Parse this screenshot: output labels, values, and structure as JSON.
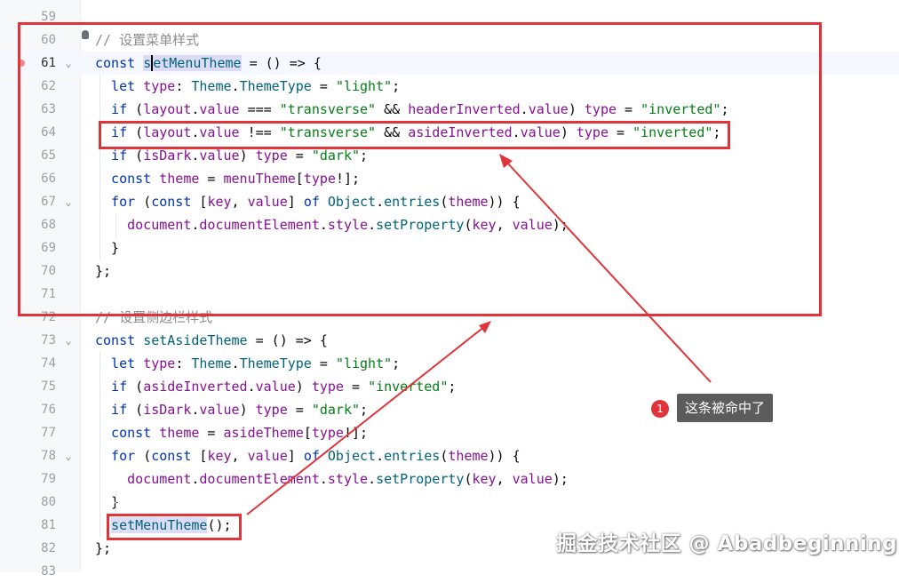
{
  "editor": {
    "lines": [
      {
        "num": "59",
        "fold": "",
        "parts": []
      },
      {
        "num": "60",
        "fold": "",
        "parts": [
          {
            "t": "// 设置菜单样式",
            "c": "cm"
          }
        ]
      },
      {
        "num": "61",
        "fold": "⌄",
        "current": true,
        "parts": [
          {
            "t": "const ",
            "c": "kw"
          },
          {
            "t": "s",
            "c": "fn hl"
          },
          {
            "t": "etMenuTheme",
            "c": "fn hl caret"
          },
          {
            "t": " = () => {",
            "c": ""
          }
        ]
      },
      {
        "num": "62",
        "fold": "",
        "parts": [
          {
            "t": "  let ",
            "c": "kw"
          },
          {
            "t": "type",
            "c": "id"
          },
          {
            "t": ": ",
            "c": ""
          },
          {
            "t": "Theme",
            "c": "type"
          },
          {
            "t": ".",
            "c": ""
          },
          {
            "t": "ThemeType",
            "c": "type"
          },
          {
            "t": " = ",
            "c": ""
          },
          {
            "t": "\"light\"",
            "c": "str"
          },
          {
            "t": ";",
            "c": ""
          }
        ]
      },
      {
        "num": "63",
        "fold": "",
        "parts": [
          {
            "t": "  if ",
            "c": "kw"
          },
          {
            "t": "(",
            "c": ""
          },
          {
            "t": "layout",
            "c": "id"
          },
          {
            "t": ".",
            "c": ""
          },
          {
            "t": "value",
            "c": "prop"
          },
          {
            "t": " === ",
            "c": ""
          },
          {
            "t": "\"transverse\"",
            "c": "str"
          },
          {
            "t": " && ",
            "c": ""
          },
          {
            "t": "headerInverted",
            "c": "id"
          },
          {
            "t": ".",
            "c": ""
          },
          {
            "t": "value",
            "c": "prop"
          },
          {
            "t": ") ",
            "c": ""
          },
          {
            "t": "type",
            "c": "id"
          },
          {
            "t": " = ",
            "c": ""
          },
          {
            "t": "\"inverted\"",
            "c": "str"
          },
          {
            "t": ";",
            "c": ""
          }
        ]
      },
      {
        "num": "64",
        "fold": "",
        "parts": [
          {
            "t": "  if ",
            "c": "kw"
          },
          {
            "t": "(",
            "c": ""
          },
          {
            "t": "layout",
            "c": "id"
          },
          {
            "t": ".",
            "c": ""
          },
          {
            "t": "value",
            "c": "prop"
          },
          {
            "t": " !== ",
            "c": ""
          },
          {
            "t": "\"transverse\"",
            "c": "str"
          },
          {
            "t": " && ",
            "c": ""
          },
          {
            "t": "asideInverted",
            "c": "id"
          },
          {
            "t": ".",
            "c": ""
          },
          {
            "t": "value",
            "c": "prop"
          },
          {
            "t": ") ",
            "c": ""
          },
          {
            "t": "type",
            "c": "id"
          },
          {
            "t": " = ",
            "c": ""
          },
          {
            "t": "\"inverted\"",
            "c": "str"
          },
          {
            "t": ";",
            "c": ""
          }
        ]
      },
      {
        "num": "65",
        "fold": "",
        "parts": [
          {
            "t": "  if ",
            "c": "kw"
          },
          {
            "t": "(",
            "c": ""
          },
          {
            "t": "isDark",
            "c": "id"
          },
          {
            "t": ".",
            "c": ""
          },
          {
            "t": "value",
            "c": "prop"
          },
          {
            "t": ") ",
            "c": ""
          },
          {
            "t": "type",
            "c": "id"
          },
          {
            "t": " = ",
            "c": ""
          },
          {
            "t": "\"dark\"",
            "c": "str"
          },
          {
            "t": ";",
            "c": ""
          }
        ]
      },
      {
        "num": "66",
        "fold": "",
        "parts": [
          {
            "t": "  const ",
            "c": "kw"
          },
          {
            "t": "theme",
            "c": "id"
          },
          {
            "t": " = ",
            "c": ""
          },
          {
            "t": "menuTheme",
            "c": "id"
          },
          {
            "t": "[",
            "c": ""
          },
          {
            "t": "type",
            "c": "id"
          },
          {
            "t": "!];",
            "c": ""
          }
        ]
      },
      {
        "num": "67",
        "fold": "⌄",
        "parts": [
          {
            "t": "  for ",
            "c": "kw"
          },
          {
            "t": "(",
            "c": ""
          },
          {
            "t": "const ",
            "c": "kw"
          },
          {
            "t": "[",
            "c": ""
          },
          {
            "t": "key",
            "c": "id"
          },
          {
            "t": ", ",
            "c": ""
          },
          {
            "t": "value",
            "c": "id"
          },
          {
            "t": "] ",
            "c": ""
          },
          {
            "t": "of ",
            "c": "kw"
          },
          {
            "t": "Object",
            "c": "type"
          },
          {
            "t": ".",
            "c": ""
          },
          {
            "t": "entries",
            "c": "fn"
          },
          {
            "t": "(",
            "c": ""
          },
          {
            "t": "theme",
            "c": "id"
          },
          {
            "t": ")) {",
            "c": ""
          }
        ]
      },
      {
        "num": "68",
        "fold": "",
        "parts": [
          {
            "t": "    ",
            "c": ""
          },
          {
            "t": "document",
            "c": "id"
          },
          {
            "t": ".",
            "c": ""
          },
          {
            "t": "documentElement",
            "c": "prop"
          },
          {
            "t": ".",
            "c": ""
          },
          {
            "t": "style",
            "c": "prop"
          },
          {
            "t": ".",
            "c": ""
          },
          {
            "t": "setProperty",
            "c": "fn"
          },
          {
            "t": "(",
            "c": ""
          },
          {
            "t": "key",
            "c": "id"
          },
          {
            "t": ", ",
            "c": ""
          },
          {
            "t": "value",
            "c": "id"
          },
          {
            "t": ");",
            "c": ""
          }
        ]
      },
      {
        "num": "69",
        "fold": "",
        "parts": [
          {
            "t": "  }",
            "c": ""
          }
        ]
      },
      {
        "num": "70",
        "fold": "",
        "parts": [
          {
            "t": "};",
            "c": ""
          }
        ]
      },
      {
        "num": "71",
        "fold": "",
        "parts": []
      },
      {
        "num": "72",
        "fold": "",
        "parts": [
          {
            "t": "// 设置侧边栏样式",
            "c": "cm"
          }
        ]
      },
      {
        "num": "73",
        "fold": "⌄",
        "parts": [
          {
            "t": "const ",
            "c": "kw"
          },
          {
            "t": "setAsideTheme",
            "c": "fn"
          },
          {
            "t": " = () => {",
            "c": ""
          }
        ]
      },
      {
        "num": "74",
        "fold": "",
        "parts": [
          {
            "t": "  let ",
            "c": "kw"
          },
          {
            "t": "type",
            "c": "id"
          },
          {
            "t": ": ",
            "c": ""
          },
          {
            "t": "Theme",
            "c": "type"
          },
          {
            "t": ".",
            "c": ""
          },
          {
            "t": "ThemeType",
            "c": "type"
          },
          {
            "t": " = ",
            "c": ""
          },
          {
            "t": "\"light\"",
            "c": "str"
          },
          {
            "t": ";",
            "c": ""
          }
        ]
      },
      {
        "num": "75",
        "fold": "",
        "parts": [
          {
            "t": "  if ",
            "c": "kw"
          },
          {
            "t": "(",
            "c": ""
          },
          {
            "t": "asideInverted",
            "c": "id"
          },
          {
            "t": ".",
            "c": ""
          },
          {
            "t": "value",
            "c": "prop"
          },
          {
            "t": ") ",
            "c": ""
          },
          {
            "t": "type",
            "c": "id"
          },
          {
            "t": " = ",
            "c": ""
          },
          {
            "t": "\"inverted\"",
            "c": "str"
          },
          {
            "t": ";",
            "c": ""
          }
        ]
      },
      {
        "num": "76",
        "fold": "",
        "parts": [
          {
            "t": "  if ",
            "c": "kw"
          },
          {
            "t": "(",
            "c": ""
          },
          {
            "t": "isDark",
            "c": "id"
          },
          {
            "t": ".",
            "c": ""
          },
          {
            "t": "value",
            "c": "prop"
          },
          {
            "t": ") ",
            "c": ""
          },
          {
            "t": "type",
            "c": "id"
          },
          {
            "t": " = ",
            "c": ""
          },
          {
            "t": "\"dark\"",
            "c": "str"
          },
          {
            "t": ";",
            "c": ""
          }
        ]
      },
      {
        "num": "77",
        "fold": "",
        "parts": [
          {
            "t": "  const ",
            "c": "kw"
          },
          {
            "t": "theme",
            "c": "id"
          },
          {
            "t": " = ",
            "c": ""
          },
          {
            "t": "asideTheme",
            "c": "id"
          },
          {
            "t": "[",
            "c": ""
          },
          {
            "t": "type",
            "c": "id"
          },
          {
            "t": "!];",
            "c": ""
          }
        ]
      },
      {
        "num": "78",
        "fold": "⌄",
        "parts": [
          {
            "t": "  for ",
            "c": "kw"
          },
          {
            "t": "(",
            "c": ""
          },
          {
            "t": "const ",
            "c": "kw"
          },
          {
            "t": "[",
            "c": ""
          },
          {
            "t": "key",
            "c": "id"
          },
          {
            "t": ", ",
            "c": ""
          },
          {
            "t": "value",
            "c": "id"
          },
          {
            "t": "] ",
            "c": ""
          },
          {
            "t": "of ",
            "c": "kw"
          },
          {
            "t": "Object",
            "c": "type"
          },
          {
            "t": ".",
            "c": ""
          },
          {
            "t": "entries",
            "c": "fn"
          },
          {
            "t": "(",
            "c": ""
          },
          {
            "t": "theme",
            "c": "id"
          },
          {
            "t": ")) {",
            "c": ""
          }
        ]
      },
      {
        "num": "79",
        "fold": "",
        "parts": [
          {
            "t": "    ",
            "c": ""
          },
          {
            "t": "document",
            "c": "id"
          },
          {
            "t": ".",
            "c": ""
          },
          {
            "t": "documentElement",
            "c": "prop"
          },
          {
            "t": ".",
            "c": ""
          },
          {
            "t": "style",
            "c": "prop"
          },
          {
            "t": ".",
            "c": ""
          },
          {
            "t": "setProperty",
            "c": "fn"
          },
          {
            "t": "(",
            "c": ""
          },
          {
            "t": "key",
            "c": "id"
          },
          {
            "t": ", ",
            "c": ""
          },
          {
            "t": "value",
            "c": "id"
          },
          {
            "t": ");",
            "c": ""
          }
        ]
      },
      {
        "num": "80",
        "fold": "",
        "parts": [
          {
            "t": "  }",
            "c": ""
          }
        ]
      },
      {
        "num": "81",
        "fold": "",
        "parts": [
          {
            "t": "  ",
            "c": ""
          },
          {
            "t": "setMenuTheme",
            "c": "fn hl"
          },
          {
            "t": "();",
            "c": ""
          }
        ]
      },
      {
        "num": "82",
        "fold": "",
        "parts": [
          {
            "t": "};",
            "c": ""
          }
        ]
      },
      {
        "num": "83",
        "fold": "",
        "parts": []
      }
    ]
  },
  "callout": {
    "badge": "1",
    "label": "这条被命中了"
  },
  "watermark": "掘金技术社区 @ Abadbeginning",
  "colors": {
    "annotation_red": "#e0343a",
    "keyword": "#0033b3",
    "string": "#067d17",
    "comment": "#8c8c8c"
  }
}
